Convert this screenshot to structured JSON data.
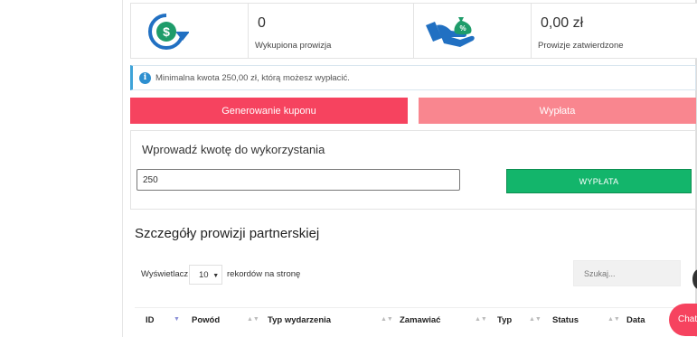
{
  "stats": {
    "purchased_value": "0",
    "purchased_label": "Wykupiona prowizja",
    "approved_value": "0,00 zł",
    "approved_label": "Prowizje zatwierdzone",
    "icons": [
      "refresh-dollar-icon",
      "hand-money-bag-icon"
    ]
  },
  "info": {
    "text": "Minimalna kwota 250,00 zł, którą możesz wypłacić."
  },
  "actions": {
    "coupon_label": "Generowanie kuponu",
    "payout_label": "Wypłata"
  },
  "form": {
    "title": "Wprowadź kwotę do wykorzystania",
    "amount_value": "250",
    "submit_label": "WYPŁATA"
  },
  "details": {
    "title": "Szczegóły prowizji partnerskiej",
    "show_label": "Wyświetlacz",
    "page_size": "10",
    "records_label": "rekordów na stronę",
    "search_placeholder": "Szukaj...",
    "columns": [
      "ID",
      "Powód",
      "Typ wydarzenia",
      "Zamawiać",
      "Typ",
      "Status",
      "Data"
    ]
  },
  "chat": {
    "label": "Chat"
  },
  "colors": {
    "accent": "#f6435f",
    "accent_light": "#f9868f",
    "success": "#13b56b",
    "info": "#2d8fd0"
  }
}
